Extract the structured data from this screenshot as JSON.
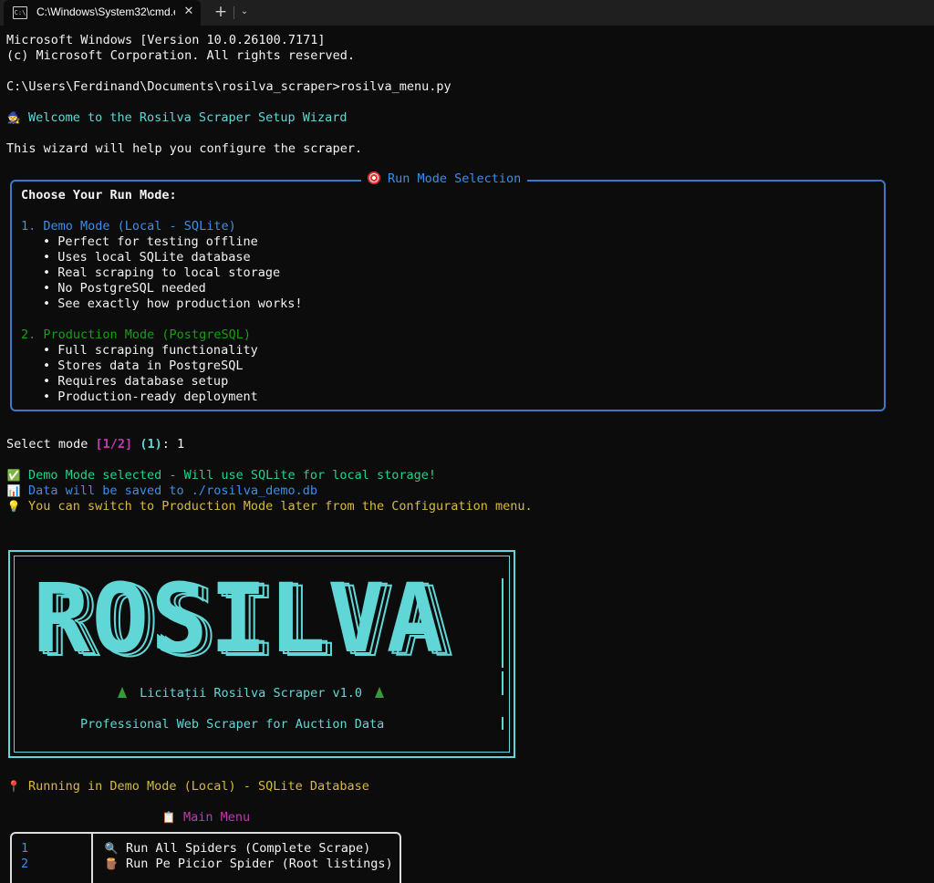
{
  "window": {
    "tab_title": "C:\\Windows\\System32\\cmd.e",
    "tab_icon_text": "C:\\",
    "close_glyph": "✕",
    "new_tab_glyph": "+",
    "dropdown_glyph": "⌄"
  },
  "console": {
    "header1": "Microsoft Windows [Version 10.0.26100.7171]",
    "header2": "(c) Microsoft Corporation. All rights reserved.",
    "prompt": "C:\\Users\\Ferdinand\\Documents\\rosilva_scraper>rosilva_menu.py",
    "welcome_emoji": "🧙",
    "welcome": "Welcome to the Rosilva Scraper Setup Wizard",
    "intro": "This wizard will help you configure the scraper."
  },
  "run_mode": {
    "panel_title": "Run Mode Selection",
    "heading": "Choose Your Run Mode:",
    "demo_title": "1. Demo Mode (Local - SQLite)",
    "demo_bullets": [
      "• Perfect for testing offline",
      "• Uses local SQLite database",
      "• Real scraping to local storage",
      "• No PostgreSQL needed",
      "• See exactly how production works!"
    ],
    "prod_title": "2. Production Mode (PostgreSQL)",
    "prod_bullets": [
      "• Full scraping functionality",
      "• Stores data in PostgreSQL",
      "• Requires database setup",
      "• Production-ready deployment"
    ]
  },
  "prompt_select": {
    "label": "Select mode ",
    "choices": "[1/2]",
    "default": " (1)",
    "colon": ": ",
    "answer": "1"
  },
  "messages": {
    "selected_emoji": "✅",
    "selected": "Demo Mode selected - Will use SQLite for local storage!",
    "saved_emoji": "📊",
    "saved": "Data will be saved to ./rosilva_demo.db",
    "tip_emoji": "💡",
    "tip": "You can switch to Production Mode later from the Configuration menu."
  },
  "banner": {
    "logo": "ROSILVA",
    "title": "Licitații Rosilva Scraper v1.0",
    "subtitle": "Professional Web Scraper for Auction Data"
  },
  "status": {
    "pin_emoji": "📍",
    "text": "Running in Demo Mode (Local) - SQLite Database"
  },
  "main_menu": {
    "emoji": "📋",
    "title": "Main Menu",
    "items": [
      {
        "num": "1",
        "emoji": "🔍",
        "label": "Run All Spiders (Complete Scrape)"
      },
      {
        "num": "2",
        "emoji": "🪵",
        "label": "Run Pe Picior Spider (Root listings)"
      }
    ]
  },
  "colors": {
    "background": "#0c0c0c",
    "cyan": "#61d6d6",
    "blue": "#3b8eea",
    "green": "#23d18b",
    "yellow": "#e5c07b",
    "magenta": "#c239b3"
  }
}
